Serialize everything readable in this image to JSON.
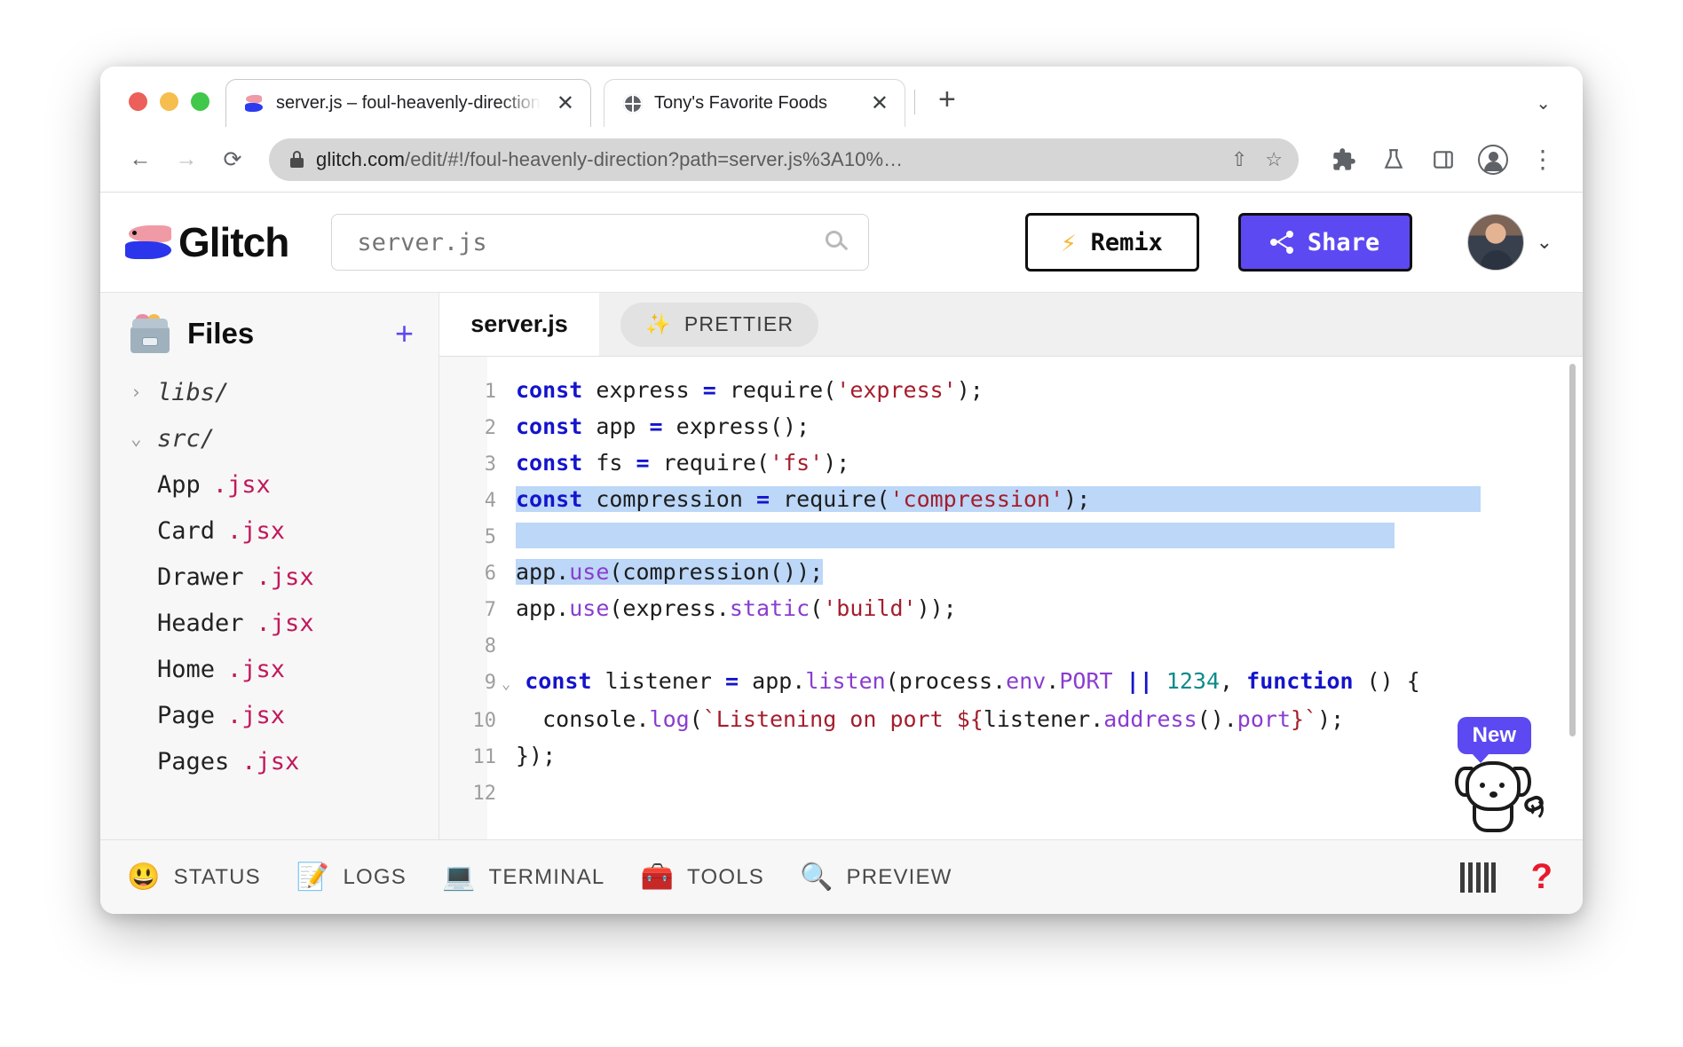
{
  "browser": {
    "tabs": [
      {
        "title": "server.js – foul-heavenly-direction",
        "favicon": "glitch-fish-icon",
        "active": true,
        "close_label": "✕"
      },
      {
        "title": "Tony's Favorite Foods",
        "favicon": "globe-icon",
        "active": false,
        "close_label": "✕"
      }
    ],
    "new_tab_label": "+",
    "tabstrip_caret": "⌄",
    "nav": {
      "back": "←",
      "forward": "→",
      "reload": "⟳"
    },
    "url_prefix": "glitch.com",
    "url_rest": "/edit/#!/foul-heavenly-direction?path=server.js%3A10%…",
    "omnibox_icons": {
      "share": "⇧",
      "bookmark": "☆"
    },
    "toolbar_icons": {
      "extensions": "🧩",
      "labs": "⚗",
      "sidepanel": "▯",
      "menu": "⋮"
    }
  },
  "glitch_header": {
    "logo_text": "Glitch",
    "project_search_value": "server.js",
    "project_search_placeholder": "server.js",
    "search_icon": "magnifier-icon",
    "remix_label": "Remix",
    "remix_icon": "⚡",
    "share_label": "Share",
    "share_icon": "share-nodes-icon",
    "account_caret": "⌄"
  },
  "sidebar": {
    "title": "Files",
    "add_label": "+",
    "tree": [
      {
        "type": "folder",
        "name": "libs/",
        "twisty": "›",
        "expanded": false
      },
      {
        "type": "folder",
        "name": "src/",
        "twisty": "⌄",
        "expanded": true
      },
      {
        "type": "file",
        "base": "App",
        "ext": ".jsx"
      },
      {
        "type": "file",
        "base": "Card",
        "ext": ".jsx"
      },
      {
        "type": "file",
        "base": "Drawer",
        "ext": ".jsx"
      },
      {
        "type": "file",
        "base": "Header",
        "ext": ".jsx"
      },
      {
        "type": "file",
        "base": "Home",
        "ext": ".jsx"
      },
      {
        "type": "file",
        "base": "Page",
        "ext": ".jsx"
      },
      {
        "type": "file",
        "base": "Pages",
        "ext": ".jsx"
      }
    ]
  },
  "editor": {
    "tab_label": "server.js",
    "prettier_label": "PRETTIER",
    "prettier_icon": "✨",
    "lines": [
      {
        "n": "1",
        "fold": "",
        "text": "const express = require('express');"
      },
      {
        "n": "2",
        "fold": "",
        "text": "const app = express();"
      },
      {
        "n": "3",
        "fold": "",
        "text": "const fs = require('fs');"
      },
      {
        "n": "4",
        "fold": "",
        "text": "const compression = require('compression');",
        "selected": true
      },
      {
        "n": "5",
        "fold": "",
        "text": "",
        "selected": true
      },
      {
        "n": "6",
        "fold": "",
        "text": "app.use(compression());",
        "selected": true
      },
      {
        "n": "7",
        "fold": "",
        "text": "app.use(express.static('build'));"
      },
      {
        "n": "8",
        "fold": "",
        "text": ""
      },
      {
        "n": "9",
        "fold": "⌄",
        "text": "const listener = app.listen(process.env.PORT || 1234, function () {"
      },
      {
        "n": "10",
        "fold": "",
        "text": "  console.log(`Listening on port ${listener.address().port}`);"
      },
      {
        "n": "11",
        "fold": "",
        "text": "});"
      },
      {
        "n": "12",
        "fold": "",
        "text": ""
      }
    ],
    "new_badge": "New",
    "mascot": "dog-mascot-icon"
  },
  "footer": {
    "items": [
      {
        "icon": "😃",
        "label": "STATUS",
        "icon_name": "smiley-icon"
      },
      {
        "icon": "📝",
        "label": "LOGS",
        "icon_name": "notepad-icon"
      },
      {
        "icon": "💻",
        "label": "TERMINAL",
        "icon_name": "laptop-icon"
      },
      {
        "icon": "🧰",
        "label": "TOOLS",
        "icon_name": "toolbox-icon"
      },
      {
        "icon": "🔍",
        "label": "PREVIEW",
        "icon_name": "magnifier-icon"
      }
    ],
    "piano_icon": "piano-keys-icon",
    "help_label": "?"
  },
  "colors": {
    "accent_purple": "#5c49f2",
    "selection_blue": "#bcd7f7",
    "keyword_blue": "#1414cc",
    "string_red": "#a51d2d",
    "method_purple": "#8a3ccf",
    "number_teal": "#0f8a8a",
    "file_ext_pink": "#c2185b",
    "help_red": "#e8192c"
  }
}
